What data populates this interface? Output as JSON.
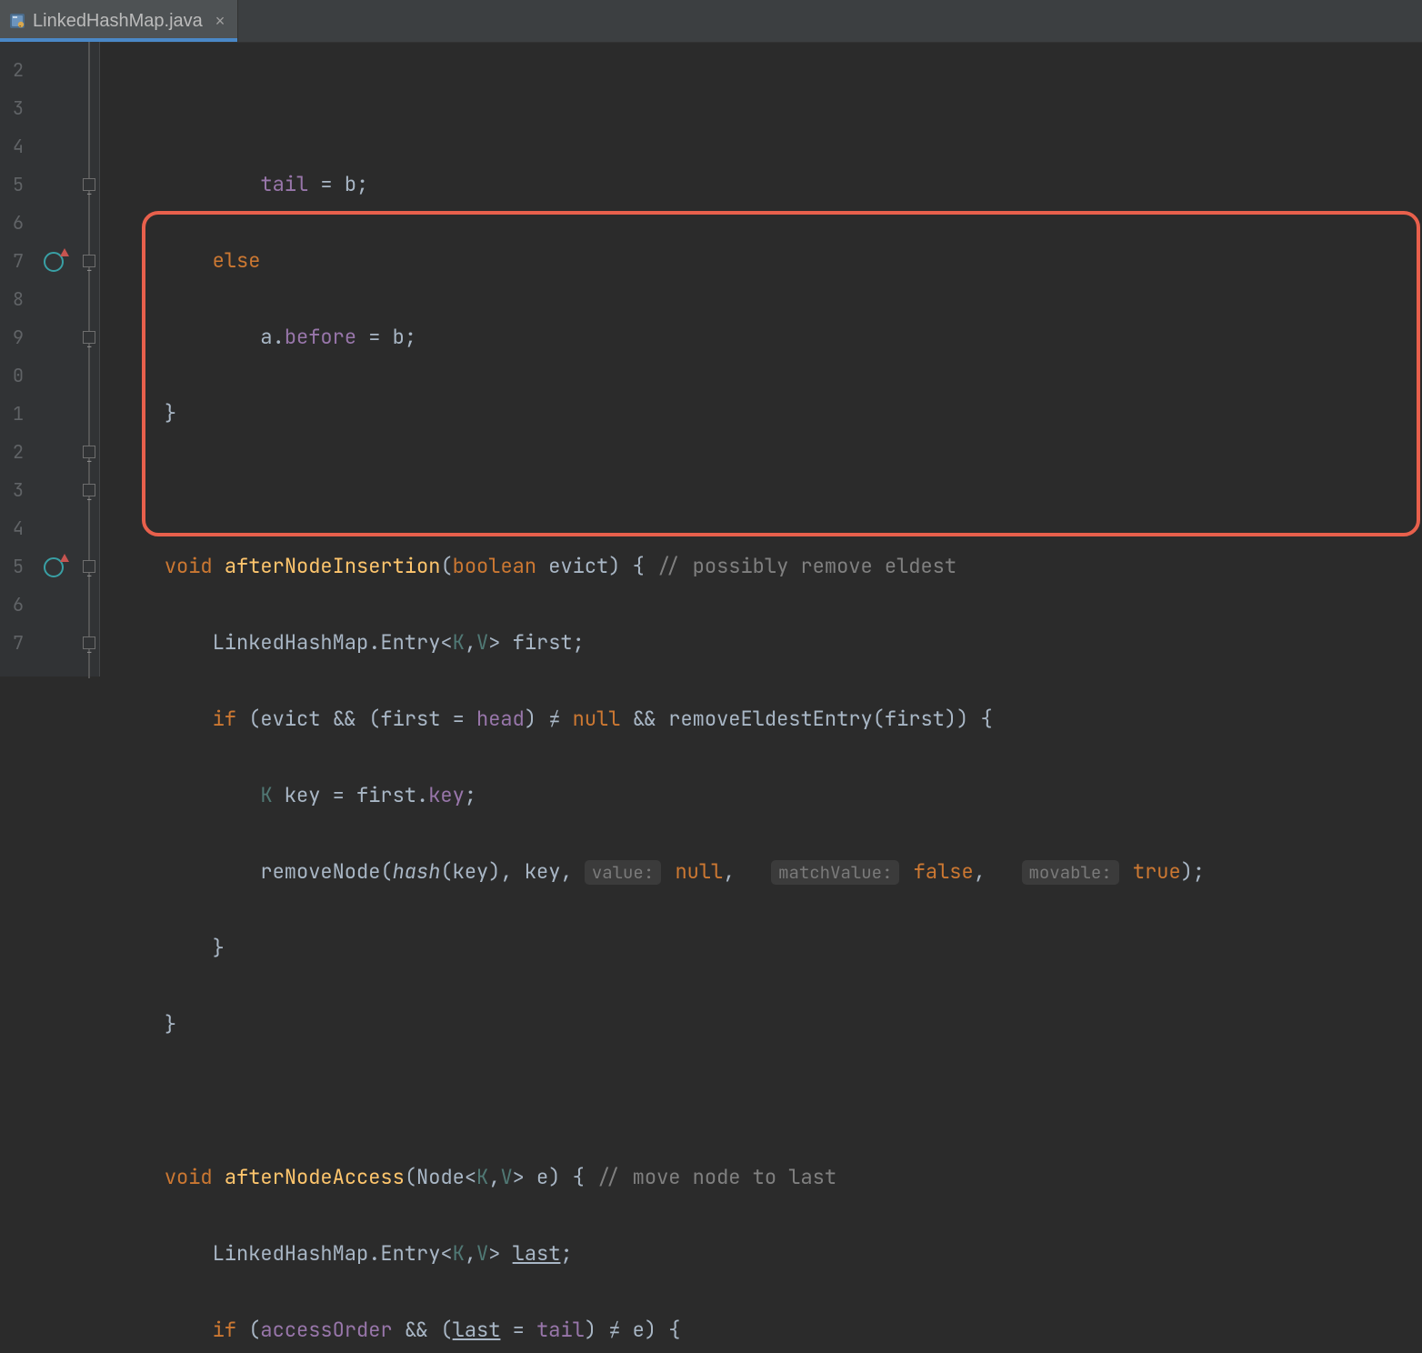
{
  "tab": {
    "filename": "LinkedHashMap.java",
    "close_glyph": "×"
  },
  "line_numbers": [
    "2",
    "3",
    "4",
    "5",
    "6",
    "7",
    "8",
    "9",
    "0",
    "1",
    "2",
    "3",
    "4",
    "5",
    "6",
    "7"
  ],
  "code": {
    "l1": {
      "ind": "            ",
      "a": "tail",
      "b": " = b;"
    },
    "l2": {
      "ind": "        ",
      "a": "else"
    },
    "l3": {
      "ind": "            ",
      "a": "a.",
      "b": "before",
      "c": " = b;"
    },
    "l4": {
      "ind": "    ",
      "a": "}"
    },
    "l5": "",
    "l6": {
      "ind": "    ",
      "a": "void",
      "b": " ",
      "c": "afterNodeInsertion",
      "d": "(",
      "e": "boolean",
      "f": " evict) { ",
      "g": "// possibly remove eldest"
    },
    "l7": {
      "ind": "        ",
      "a": "LinkedHashMap.Entry<",
      "b": "K",
      "c": ",",
      "d": "V",
      "e": "> first;"
    },
    "l8": {
      "ind": "        ",
      "a": "if",
      "b": " (evict && (first = ",
      "c": "head",
      "d": ") ≠ ",
      "e": "null",
      "f": " && removeEldestEntry(first)) {"
    },
    "l9": {
      "ind": "            ",
      "a": "K",
      "b": " key = first.",
      "c": "key",
      "d": ";"
    },
    "l10": {
      "ind": "            ",
      "a": "removeNode(",
      "b": "hash",
      "c": "(key), key, ",
      "h1": "value:",
      "d": " ",
      "e": "null",
      "f": ", ",
      "h2": "matchValue:",
      "g": " ",
      "h": "false",
      "i": ", ",
      "h3": "movable:",
      "j": " ",
      "k": "true",
      "l": ");"
    },
    "l11": {
      "ind": "        ",
      "a": "}"
    },
    "l12": {
      "ind": "    ",
      "a": "}"
    },
    "l13": "",
    "l14": {
      "ind": "    ",
      "a": "void",
      "b": " ",
      "c": "afterNodeAccess",
      "d": "(Node<",
      "e": "K",
      "f": ",",
      "g": "V",
      "h": "> e) { ",
      "i": "// move node to last"
    },
    "l15": {
      "ind": "        ",
      "a": "LinkedHashMap.Entry<",
      "b": "K",
      "c": ",",
      "d": "V",
      "e": "> ",
      "f": "last",
      "g": ";"
    },
    "l16": {
      "ind": "        ",
      "a": "if",
      "b": " (",
      "c": "accessOrder",
      "d": " && (",
      "e": "last",
      "f": " = ",
      "g": "tail",
      "h": ") ≠ e) {"
    }
  }
}
